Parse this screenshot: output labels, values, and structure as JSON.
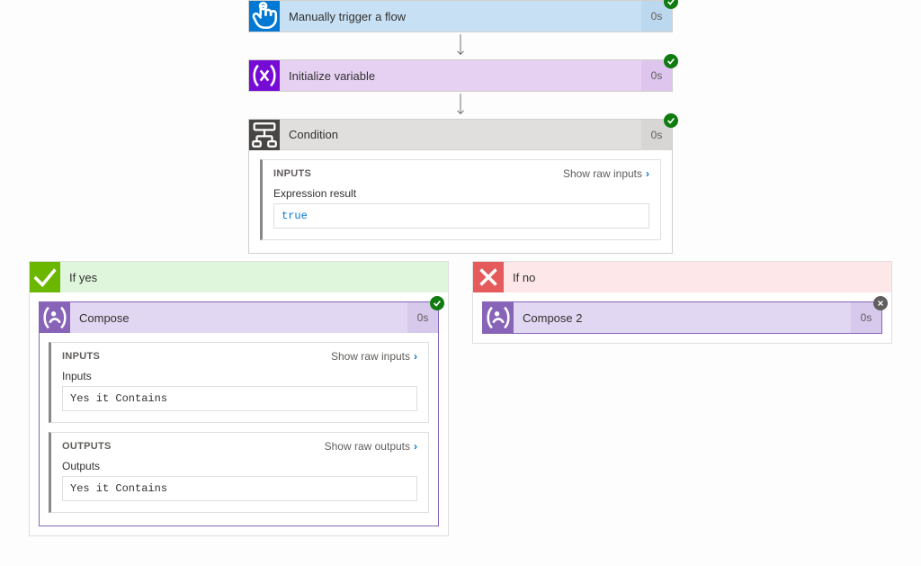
{
  "trigger": {
    "title": "Manually trigger a flow",
    "duration": "0s"
  },
  "initvar": {
    "title": "Initialize variable",
    "duration": "0s"
  },
  "condition": {
    "title": "Condition",
    "duration": "0s",
    "inputs_section_title": "INPUTS",
    "show_raw_inputs": "Show raw inputs",
    "expression_label": "Expression result",
    "expression_value": "true"
  },
  "ifyes": {
    "title": "If yes",
    "compose": {
      "title": "Compose",
      "duration": "0s",
      "inputs_section_title": "INPUTS",
      "show_raw_inputs": "Show raw inputs",
      "inputs_label": "Inputs",
      "inputs_value": "Yes it Contains",
      "outputs_section_title": "OUTPUTS",
      "show_raw_outputs": "Show raw outputs",
      "outputs_label": "Outputs",
      "outputs_value": "Yes it Contains"
    }
  },
  "ifno": {
    "title": "If no",
    "compose": {
      "title": "Compose 2",
      "duration": "0s"
    }
  }
}
